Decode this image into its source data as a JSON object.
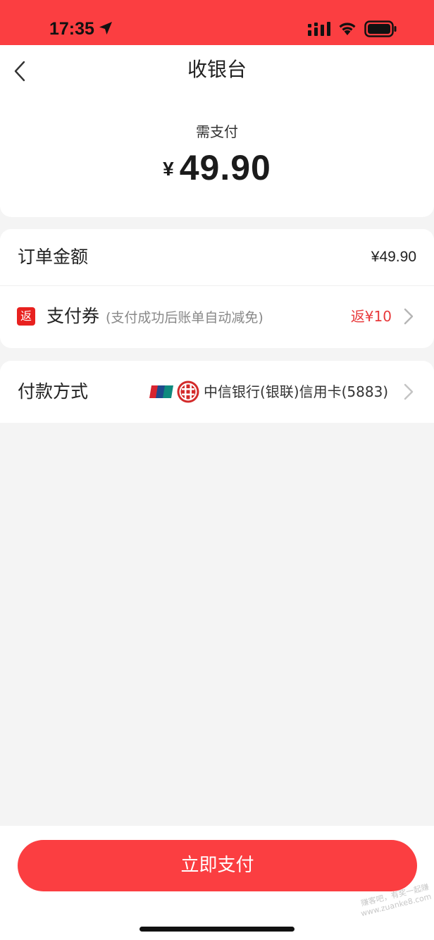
{
  "status_bar": {
    "time": "17:35"
  },
  "header": {
    "title": "收银台"
  },
  "payment_summary": {
    "label": "需支付",
    "currency": "¥",
    "amount": "49.90"
  },
  "order": {
    "amount_label": "订单金额",
    "amount_value": "¥49.90",
    "coupon_badge": "返",
    "coupon_label": "支付券",
    "coupon_hint": "(支付成功后账单自动减免)",
    "coupon_rebate": "返¥10"
  },
  "payment_method": {
    "label": "付款方式",
    "card_name": "中信银行(银联)信用卡(5883)"
  },
  "footer": {
    "pay_button": "立即支付"
  },
  "watermark": {
    "line1": "赚客吧，有奖一起赚",
    "line2": "www.zuanke8.com"
  },
  "colors": {
    "accent": "#fb3e41",
    "rebate": "#e8393b",
    "badge": "#e8211f"
  }
}
